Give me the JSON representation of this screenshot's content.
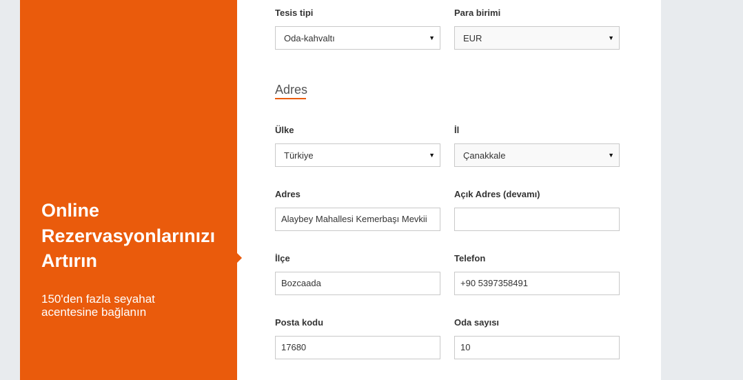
{
  "promo": {
    "title": "Online Rezervasyonlarınızı Artırın",
    "subtitle": "150'den fazla seyahat acentesine bağlanın"
  },
  "form": {
    "facility_type": {
      "label": "Tesis tipi",
      "value": "Oda-kahvaltı"
    },
    "currency": {
      "label": "Para birimi",
      "value": "EUR"
    },
    "address_section_title": "Adres",
    "country": {
      "label": "Ülke",
      "value": "Türkiye"
    },
    "province": {
      "label": "İl",
      "value": "Çanakkale"
    },
    "address": {
      "label": "Adres",
      "value": "Alaybey Mahallesi Kemerbaşı Mevkii"
    },
    "address_cont": {
      "label": "Açık Adres (devamı)",
      "value": ""
    },
    "district": {
      "label": "İlçe",
      "value": "Bozcaada"
    },
    "phone": {
      "label": "Telefon",
      "value": "+90 5397358491"
    },
    "postal_code": {
      "label": "Posta kodu",
      "value": "17680"
    },
    "room_count": {
      "label": "Oda sayısı",
      "value": "10"
    }
  },
  "icons": {
    "dropdown": "triangle-down-icon"
  },
  "colors": {
    "accent": "#ea5b0c",
    "background": "#e8ebee"
  }
}
